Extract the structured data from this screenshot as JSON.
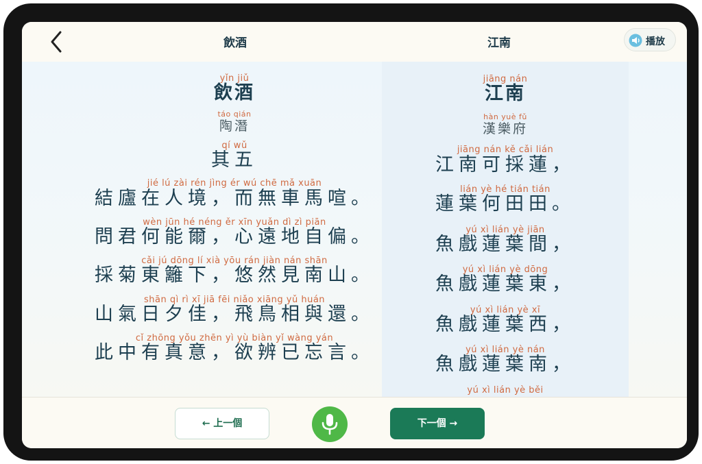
{
  "header": {
    "back_icon": "chevron-left-icon",
    "left_title": "飲酒",
    "right_title": "江南",
    "play_label": "播放",
    "play_icon": "speaker-icon"
  },
  "left_poem": {
    "title": {
      "pinyin": "yǐn jiǔ",
      "text": "飲酒"
    },
    "author": {
      "pinyin": "táo qián",
      "text": "陶潛"
    },
    "subtitle": {
      "pinyin": "qí wǔ",
      "text": "其五"
    },
    "lines": [
      {
        "pinyin": "jié lú zài rén jìng ér wú chē mǎ xuān",
        "text": "結廬在人境，而無車馬喧。"
      },
      {
        "pinyin": "wèn jūn hé néng ěr xīn yuǎn dì zì piān",
        "text": "問君何能爾，心遠地自偏。"
      },
      {
        "pinyin": "cǎi jú dōng lí xià yōu rán jiàn nán shān",
        "text": "採菊東籬下，悠然見南山。"
      },
      {
        "pinyin": "shān qì rì xī jiā fēi niǎo xiāng yǔ huán",
        "text": "山氣日夕佳，飛鳥相與還。"
      },
      {
        "pinyin": "cǐ zhōng yǒu zhēn yì yù biàn yǐ wàng yán",
        "text": "此中有真意，欲辨已忘言。"
      }
    ]
  },
  "right_poem": {
    "title": {
      "pinyin": "jiāng nán",
      "text": "江南"
    },
    "author": {
      "pinyin": "hàn yuè fǔ",
      "text": "漢樂府"
    },
    "lines": [
      {
        "pinyin": "jiāng nán kě cǎi lián",
        "text": "江南可採蓮，"
      },
      {
        "pinyin": "lián yè hé tián tián",
        "text": "蓮葉何田田。"
      },
      {
        "pinyin": "yú xì lián yè jiān",
        "text": "魚戲蓮葉間，"
      },
      {
        "pinyin": "yú xì lián yè dōng",
        "text": "魚戲蓮葉東，"
      },
      {
        "pinyin": "yú xì lián yè xī",
        "text": "魚戲蓮葉西，"
      },
      {
        "pinyin": "yú xì lián yè nán",
        "text": "魚戲蓮葉南，"
      },
      {
        "pinyin": "yú xì lián yè běi",
        "text": ""
      }
    ]
  },
  "footer": {
    "prev_label": "← 上一個",
    "next_label": "下一個 →",
    "mic_icon": "microphone-icon"
  },
  "colors": {
    "accent_green": "#1b7a57",
    "mic_green": "#4fb847",
    "pinyin": "#d06a41",
    "hanzi": "#1d3f50"
  }
}
